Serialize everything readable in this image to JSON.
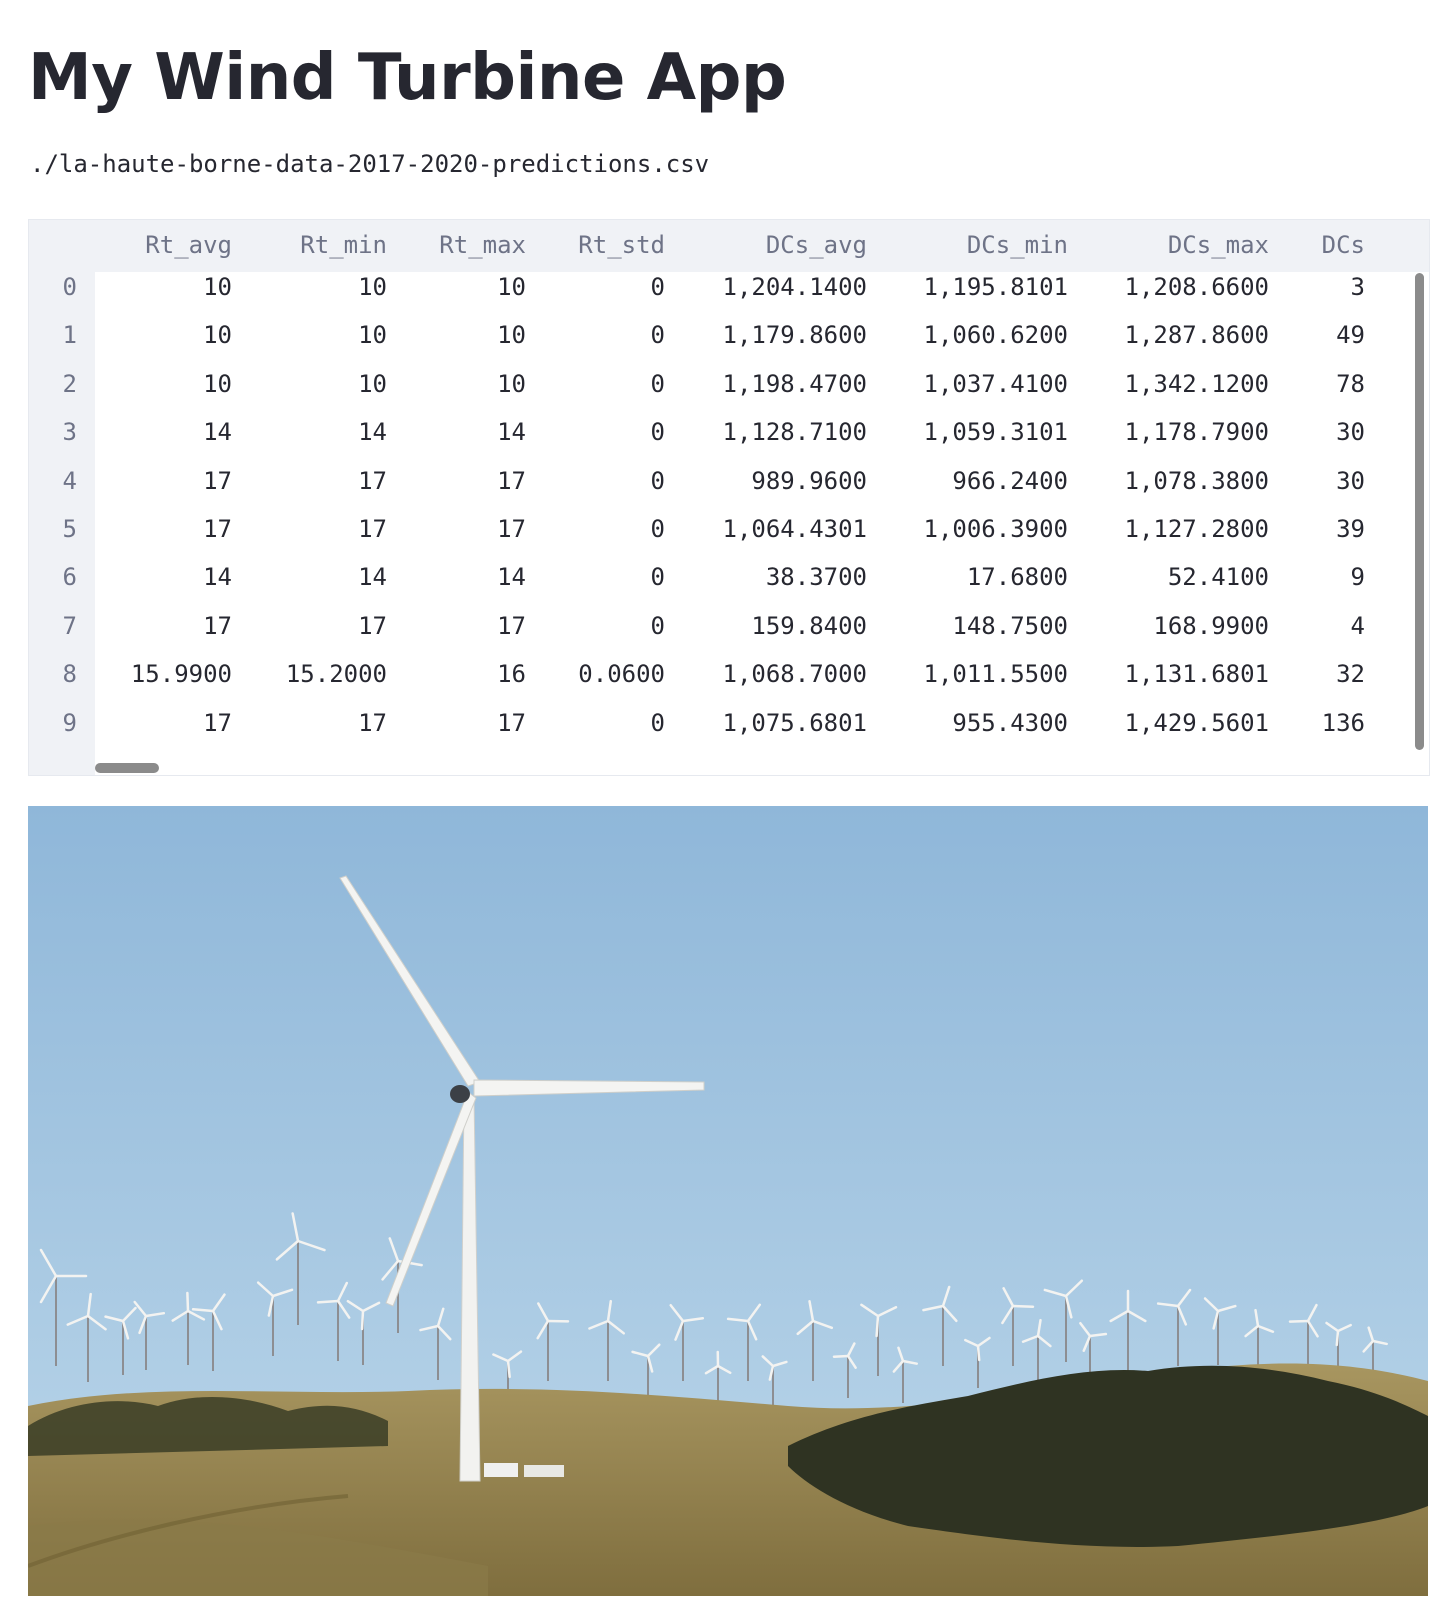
{
  "page": {
    "title": "My Wind Turbine App",
    "file_path": "./la-haute-borne-data-2017-2020-predictions.csv"
  },
  "dataframe": {
    "columns": [
      "Rt_avg",
      "Rt_min",
      "Rt_max",
      "Rt_std",
      "DCs_avg",
      "DCs_min",
      "DCs_max",
      "DCs"
    ],
    "index": [
      "0",
      "1",
      "2",
      "3",
      "4",
      "5",
      "6",
      "7",
      "8",
      "9"
    ],
    "rows": [
      [
        "10",
        "10",
        "10",
        "0",
        "1,204.1400",
        "1,195.8101",
        "1,208.6600",
        "3"
      ],
      [
        "10",
        "10",
        "10",
        "0",
        "1,179.8600",
        "1,060.6200",
        "1,287.8600",
        "49"
      ],
      [
        "10",
        "10",
        "10",
        "0",
        "1,198.4700",
        "1,037.4100",
        "1,342.1200",
        "78"
      ],
      [
        "14",
        "14",
        "14",
        "0",
        "1,128.7100",
        "1,059.3101",
        "1,178.7900",
        "30"
      ],
      [
        "17",
        "17",
        "17",
        "0",
        "989.9600",
        "966.2400",
        "1,078.3800",
        "30"
      ],
      [
        "17",
        "17",
        "17",
        "0",
        "1,064.4301",
        "1,006.3900",
        "1,127.2800",
        "39"
      ],
      [
        "14",
        "14",
        "14",
        "0",
        "38.3700",
        "17.6800",
        "52.4100",
        "9"
      ],
      [
        "17",
        "17",
        "17",
        "0",
        "159.8400",
        "148.7500",
        "168.9900",
        "4"
      ],
      [
        "15.9900",
        "15.2000",
        "16",
        "0.0600",
        "1,068.7000",
        "1,011.5500",
        "1,131.6801",
        "32"
      ],
      [
        "17",
        "17",
        "17",
        "0",
        "1,075.6801",
        "955.4300",
        "1,429.5601",
        "136"
      ]
    ]
  },
  "image": {
    "subject": "wind-turbine-farm-photo"
  },
  "colors": {
    "text": "#262730",
    "header_text": "#6e7387",
    "table_header_bg": "#f0f2f6",
    "scrollbar": "#8b8b8b",
    "sky_top": "#8fb7d9",
    "sky_bottom": "#b9d6ea",
    "hill": "#9c8a52",
    "trees": "#2e3320"
  }
}
